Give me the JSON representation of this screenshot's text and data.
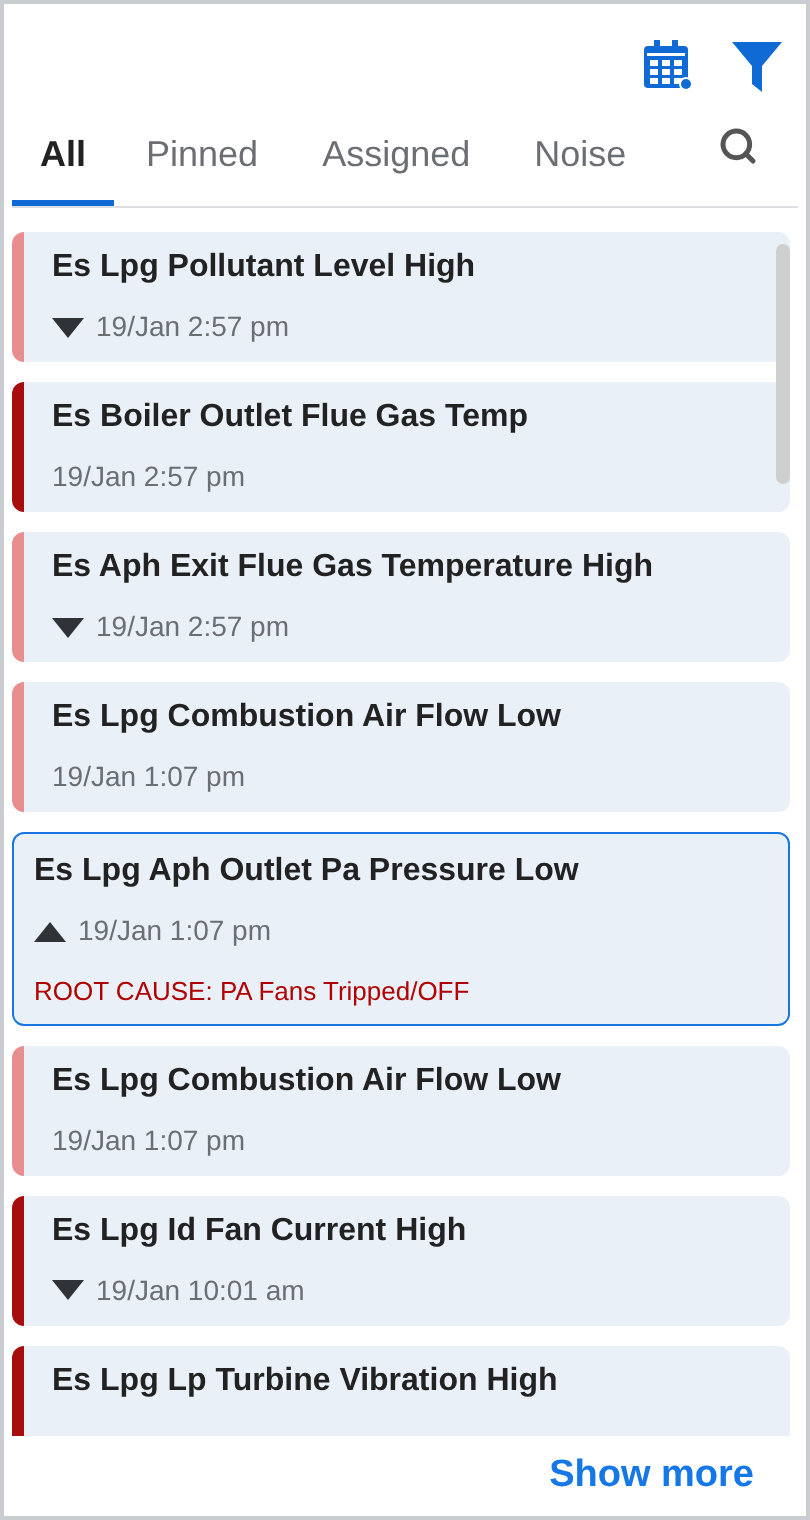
{
  "tabs": [
    {
      "label": "All",
      "selected": true
    },
    {
      "label": "Pinned",
      "selected": false
    },
    {
      "label": "Assigned",
      "selected": false
    },
    {
      "label": "Noise",
      "selected": false
    }
  ],
  "alarms": [
    {
      "title": "Es Lpg Pollutant Level High",
      "time": "19/Jan 2:57 pm",
      "kind": "falling",
      "color": "#e88e8e",
      "selected": false
    },
    {
      "title": "Es Boiler Outlet Flue Gas Temp",
      "time": "19/Jan 2:57 pm",
      "kind": "plain",
      "color": "#a80d0d",
      "selected": false
    },
    {
      "title": "Es Aph Exit Flue Gas Temperature High",
      "time": "19/Jan 2:57 pm",
      "kind": "falling",
      "color": "#e88e8e",
      "selected": false
    },
    {
      "title": "Es Lpg Combustion Air Flow Low",
      "time": "19/Jan 1:07 pm",
      "kind": "plain",
      "color": "#e88e8e",
      "selected": false
    },
    {
      "title": "Es Lpg Aph Outlet Pa Pressure Low",
      "time": "19/Jan 1:07 pm",
      "kind": "rising",
      "root_cause": "ROOT CAUSE: PA Fans Tripped/OFF",
      "selected": true
    },
    {
      "title": "Es Lpg Combustion Air Flow Low",
      "time": "19/Jan 1:07 pm",
      "kind": "plain",
      "color": "#e88e8e",
      "selected": false
    },
    {
      "title": "Es Lpg Id Fan Current High",
      "time": "19/Jan 10:01 am",
      "kind": "falling",
      "color": "#a80d0d",
      "selected": false
    },
    {
      "title": "Es Lpg Lp Turbine Vibration High",
      "color": "#a80d0d",
      "selected": false
    }
  ],
  "show_more": "Show more"
}
